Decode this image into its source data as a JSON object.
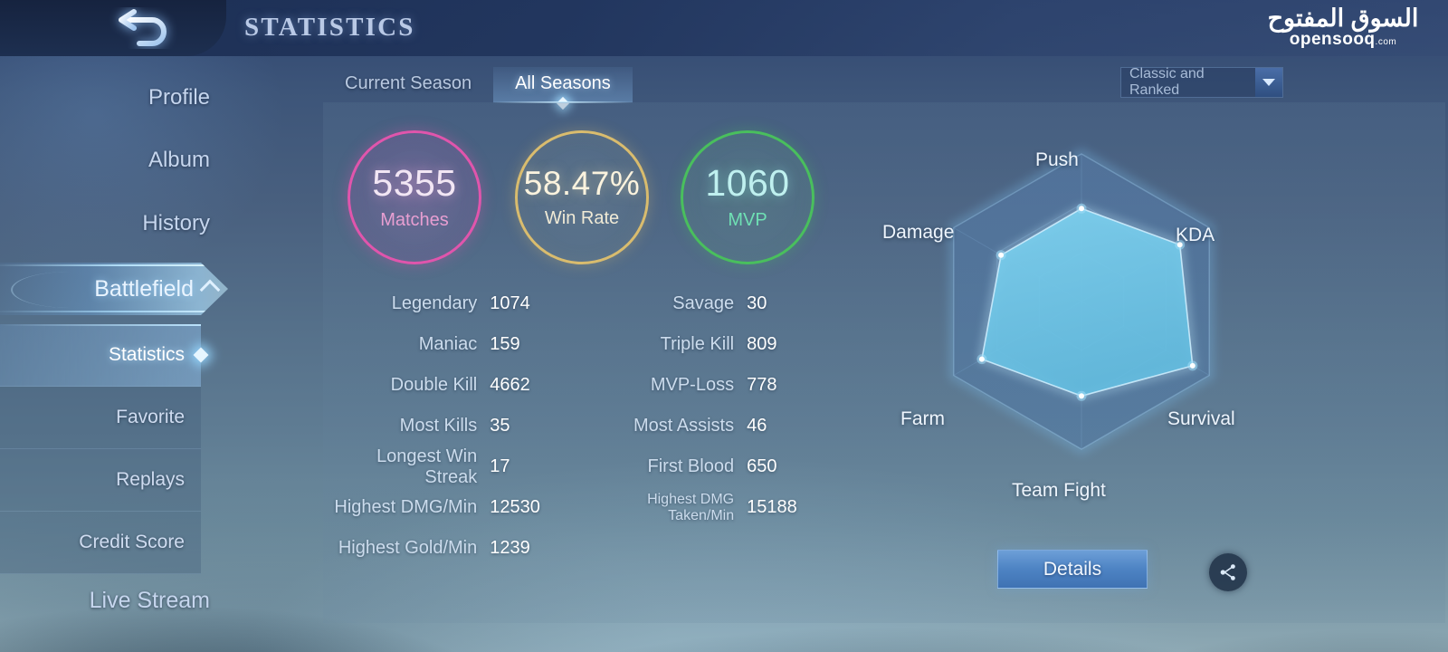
{
  "header": {
    "title": "STATISTICS",
    "back_icon": "back-arrow-icon",
    "watermark_ar": "السوق المفتوح",
    "watermark_en": "opensooq",
    "watermark_tld": ".com"
  },
  "sidebar": {
    "items": [
      {
        "label": "Profile"
      },
      {
        "label": "Album"
      },
      {
        "label": "History"
      },
      {
        "label": "Battlefield",
        "expanded": true,
        "chevron": "chevron-up-icon"
      },
      {
        "label": "Live Stream"
      }
    ],
    "submenu": [
      {
        "label": "Statistics",
        "active": true
      },
      {
        "label": "Favorite",
        "active": false
      },
      {
        "label": "Replays",
        "active": false
      },
      {
        "label": "Credit Score",
        "active": false
      }
    ]
  },
  "tabs": [
    {
      "label": "Current Season",
      "active": false
    },
    {
      "label": "All Seasons",
      "active": true
    }
  ],
  "filter": {
    "selected": "Classic and Ranked",
    "arrow_icon": "chevron-down-icon"
  },
  "summary_circles": [
    {
      "value": "5355",
      "label": "Matches",
      "ring_color": "#e055ac"
    },
    {
      "value": "58.47%",
      "label": "Win Rate",
      "ring_color": "#d9bc6e"
    },
    {
      "value": "1060",
      "label": "MVP",
      "ring_color": "#49bf5d"
    }
  ],
  "stats": [
    {
      "left_name": "Legendary",
      "left_value": "1074",
      "right_name": "Savage",
      "right_value": "30",
      "right_small": false
    },
    {
      "left_name": "Maniac",
      "left_value": "159",
      "right_name": "Triple Kill",
      "right_value": "809",
      "right_small": false
    },
    {
      "left_name": "Double Kill",
      "left_value": "4662",
      "right_name": "MVP-Loss",
      "right_value": "778",
      "right_small": false
    },
    {
      "left_name": "Most Kills",
      "left_value": "35",
      "right_name": "Most Assists",
      "right_value": "46",
      "right_small": false
    },
    {
      "left_name": "Longest Win Streak",
      "left_value": "17",
      "right_name": "First Blood",
      "right_value": "650",
      "right_small": false
    },
    {
      "left_name": "Highest DMG/Min",
      "left_value": "12530",
      "right_name": "Highest DMG Taken/Min",
      "right_value": "15188",
      "right_small": true
    },
    {
      "left_name": "Highest Gold/Min",
      "left_value": "1239",
      "right_name": "",
      "right_value": "",
      "right_small": false
    }
  ],
  "actions": {
    "details_label": "Details",
    "share_icon": "share-icon"
  },
  "chart_data": {
    "type": "radar",
    "title": "",
    "categories": [
      "Push",
      "KDA",
      "Survival",
      "Team Fight",
      "Farm",
      "Damage"
    ],
    "values": [
      63,
      77,
      87,
      64,
      78,
      63
    ],
    "max": 100,
    "rings": [
      100,
      66,
      33
    ],
    "fill_color": "#6ec6e8",
    "stroke_color": "#bfe8fb",
    "legend": "none"
  }
}
